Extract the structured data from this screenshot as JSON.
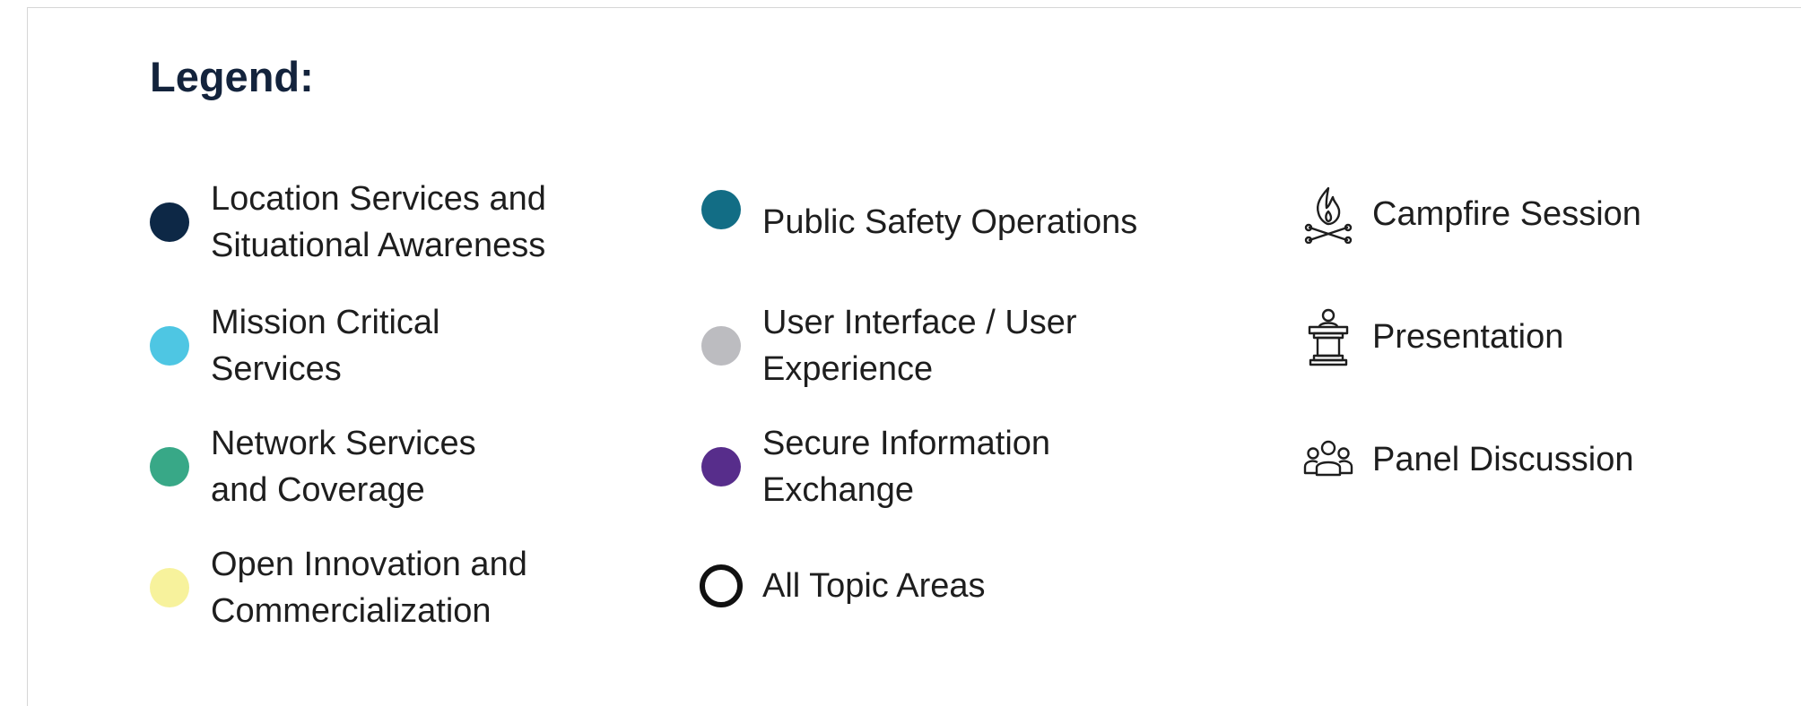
{
  "legend": {
    "title": "Legend:",
    "topics": [
      {
        "label": "Location Services and\nSituational Awareness",
        "color": "#0d2846"
      },
      {
        "label": "Mission Critical\nServices",
        "color": "#4ec6e3"
      },
      {
        "label": "Network Services\nand Coverage",
        "color": "#38a887"
      },
      {
        "label": "Open Innovation and\nCommercialization",
        "color": "#f7f29c"
      },
      {
        "label": "Public Safety Operations",
        "color": "#126d85"
      },
      {
        "label": "User Interface / User\nExperience",
        "color": "#bcbcc0"
      },
      {
        "label": "Secure Information\nExchange",
        "color": "#572d8b"
      },
      {
        "label": "All Topic Areas",
        "color": "#111111"
      }
    ],
    "session_types": [
      {
        "label": "Campfire Session",
        "icon": "campfire-icon"
      },
      {
        "label": "Presentation",
        "icon": "podium-icon"
      },
      {
        "label": "Panel Discussion",
        "icon": "group-icon"
      }
    ]
  }
}
